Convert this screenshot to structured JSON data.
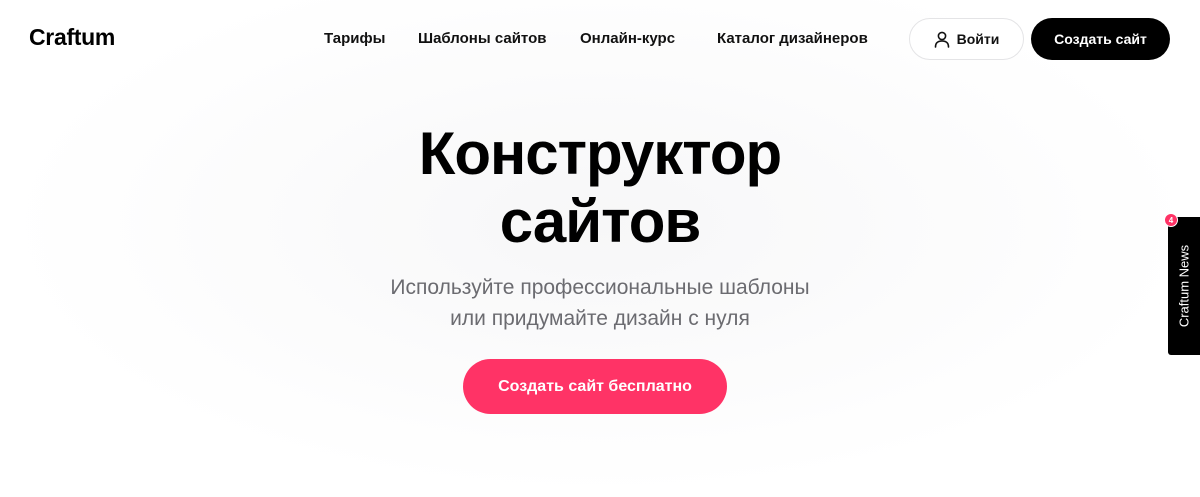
{
  "header": {
    "logo": "Craftum",
    "nav": [
      "Тарифы",
      "Шаблоны сайтов",
      "Онлайн-курс",
      "Каталог дизайнеров"
    ],
    "login_label": "Войти",
    "login_icon": "user-icon",
    "create_label": "Создать сайт"
  },
  "hero": {
    "title_line1": "Конструктор",
    "title_line2": "сайтов",
    "subtitle_line1": "Используйте профессиональные шаблоны",
    "subtitle_line2": "или придумайте дизайн с нуля",
    "cta_label": "Создать сайт бесплатно"
  },
  "news_widget": {
    "label": "Craftum News",
    "badge_count": "4"
  },
  "colors": {
    "accent": "#ff3366",
    "primary_button": "#000000",
    "subtitle_text": "#6b6b70"
  }
}
